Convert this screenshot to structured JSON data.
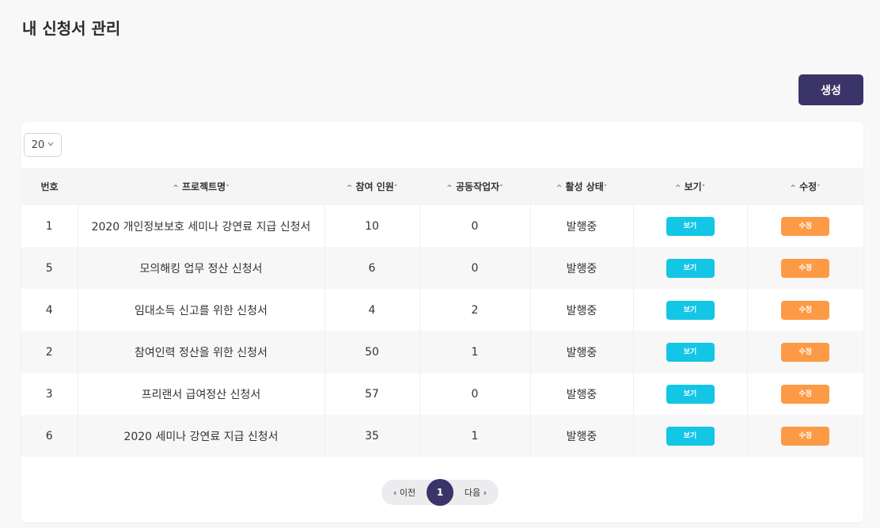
{
  "page": {
    "title": "내 신청서 관리"
  },
  "toolbar": {
    "create_label": "생성"
  },
  "page_size": {
    "value": "20"
  },
  "table": {
    "sort_asc_icon": "^",
    "sort_desc_icon": "˅",
    "headers": {
      "no": "번호",
      "project": "프로젝트명",
      "participants": "참여 인원",
      "collaborators": "공동작업자",
      "status": "활성 상태",
      "view": "보기",
      "edit": "수정"
    },
    "rows": [
      {
        "no": "1",
        "project": "2020 개인정보보호 세미나 강연료 지급 신청서",
        "participants": "10",
        "collaborators": "0",
        "status": "발행중",
        "view_label": "보기",
        "edit_label": "수정"
      },
      {
        "no": "5",
        "project": "모의해킹 업무 정산 신청서",
        "participants": "6",
        "collaborators": "0",
        "status": "발행중",
        "view_label": "보기",
        "edit_label": "수정"
      },
      {
        "no": "4",
        "project": "임대소득 신고를 위한 신청서",
        "participants": "4",
        "collaborators": "2",
        "status": "발행중",
        "view_label": "보기",
        "edit_label": "수정"
      },
      {
        "no": "2",
        "project": "참여인력 정산을 위한 신청서",
        "participants": "50",
        "collaborators": "1",
        "status": "발행중",
        "view_label": "보기",
        "edit_label": "수정"
      },
      {
        "no": "3",
        "project": "프리랜서 급여정산 신청서",
        "participants": "57",
        "collaborators": "0",
        "status": "발행중",
        "view_label": "보기",
        "edit_label": "수정"
      },
      {
        "no": "6",
        "project": "2020 세미나 강연료 지급 신청서",
        "participants": "35",
        "collaborators": "1",
        "status": "발행중",
        "view_label": "보기",
        "edit_label": "수정"
      }
    ]
  },
  "pagination": {
    "prev_label": "‹ 이전",
    "current": "1",
    "next_label": "다음 ›"
  },
  "colors": {
    "primary": "#3b3468",
    "view": "#13c6e6",
    "edit": "#fd9a45"
  }
}
